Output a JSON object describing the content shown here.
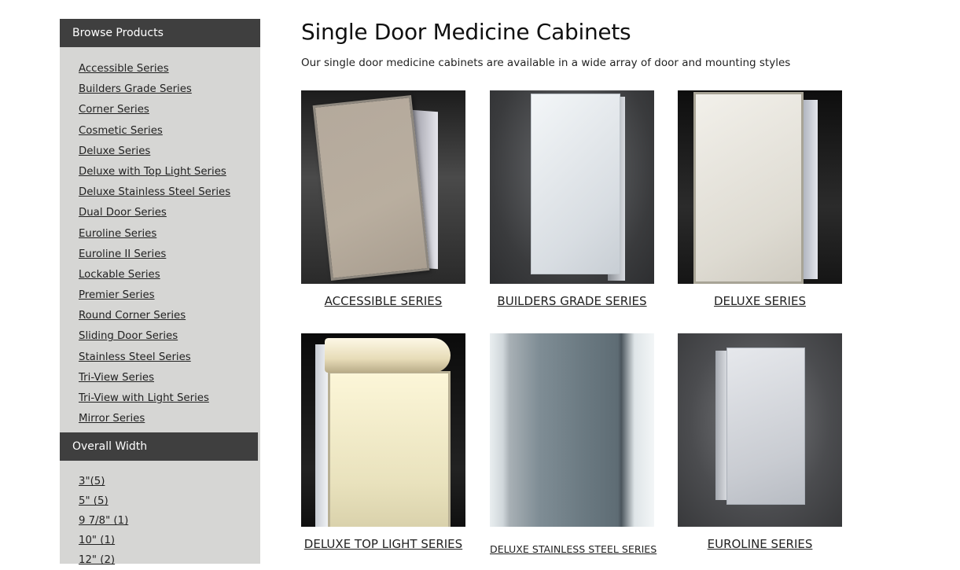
{
  "sidebar": {
    "browse_header": "Browse Products",
    "browse_items": [
      "Accessible Series",
      "Builders Grade Series",
      "Corner Series",
      "Cosmetic Series",
      "Deluxe Series",
      "Deluxe with Top Light Series",
      "Deluxe Stainless Steel Series",
      "Dual Door Series",
      "Euroline Series",
      "Euroline II Series",
      "Lockable Series",
      "Premier Series",
      "Round Corner Series",
      "Sliding Door Series",
      "Stainless Steel Series",
      "Tri-View Series",
      "Tri-View with Light Series",
      "Mirror Series"
    ],
    "width_header": "Overall Width",
    "width_items": [
      "3\"(5)",
      "5\" (5)",
      "9 7/8\" (1)",
      "10\" (1)",
      "12\" (2)"
    ]
  },
  "main": {
    "title": "Single Door Medicine Cabinets",
    "description": "Our single door medicine cabinets are available in a wide array of door and mounting styles",
    "products": [
      {
        "label": "ACCESSIBLE SERIES"
      },
      {
        "label": "BUILDERS GRADE SERIES"
      },
      {
        "label": "DELUXE SERIES"
      },
      {
        "label": "DELUXE TOP LIGHT SERIES"
      },
      {
        "label": "DELUXE STAINLESS STEEL SERIES"
      },
      {
        "label": "EUROLINE SERIES"
      }
    ]
  }
}
